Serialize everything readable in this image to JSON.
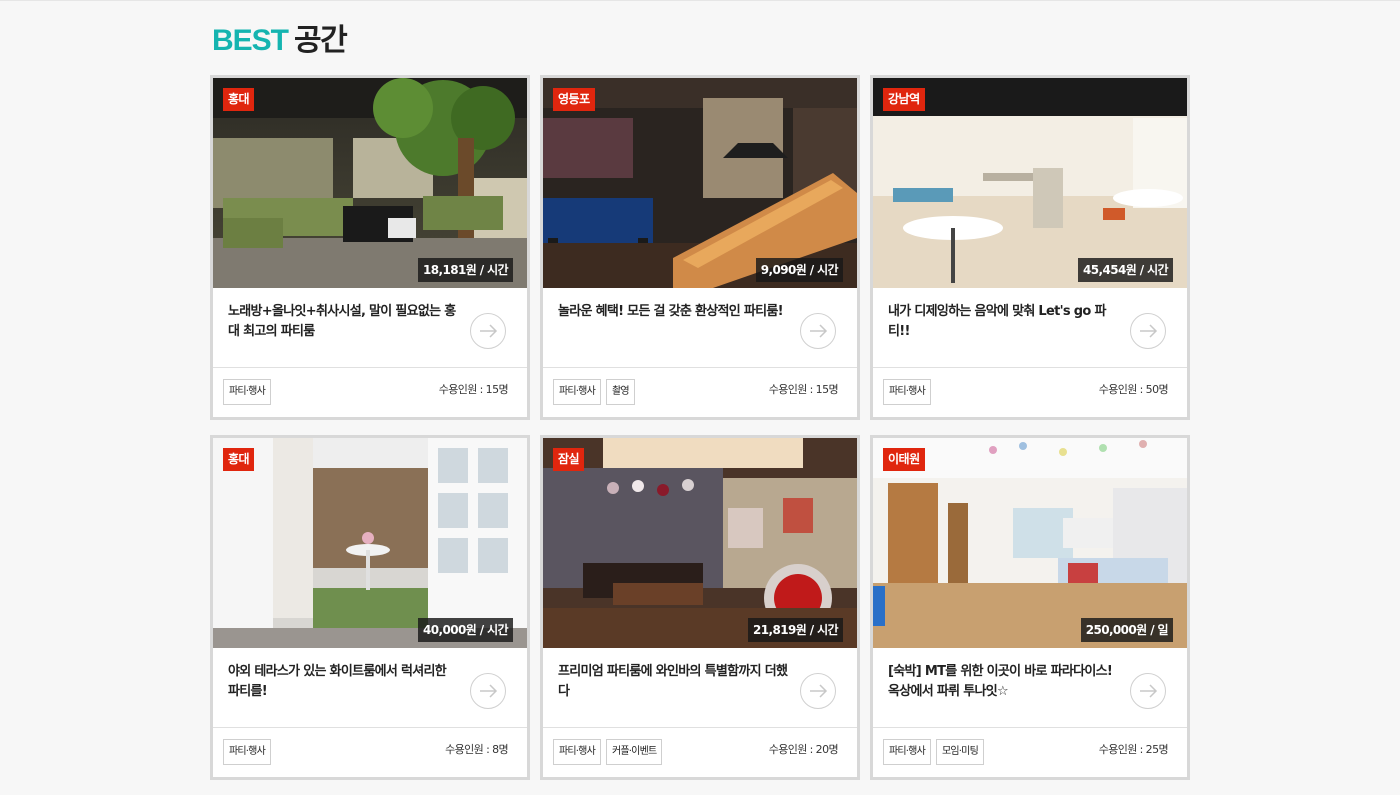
{
  "section": {
    "title_accent": "BEST",
    "title_rest": "공간"
  },
  "colors": {
    "accent": "#15b4b0",
    "badge": "#e0260e"
  },
  "cards": [
    {
      "location": "홍대",
      "price": "18,181원 / 시간",
      "description": "노래방+올나잇+취사시설, 말이 필요없는 홍대 최고의 파티룸",
      "tags": [
        "파티·행사"
      ],
      "capacity": "수용인원 : 15명"
    },
    {
      "location": "영등포",
      "price": "9,090원 / 시간",
      "description": "놀라운 혜택! 모든 걸 갖춘 환상적인 파티룸!",
      "tags": [
        "파티·행사",
        "촬영"
      ],
      "capacity": "수용인원 : 15명"
    },
    {
      "location": "강남역",
      "price": "45,454원 / 시간",
      "description": "내가 디제잉하는 음악에 맞춰 Let's go 파티!!",
      "tags": [
        "파티·행사"
      ],
      "capacity": "수용인원 : 50명"
    },
    {
      "location": "홍대",
      "price": "40,000원 / 시간",
      "description": "야외 테라스가 있는 화이트룸에서 럭셔리한 파티를!",
      "tags": [
        "파티·행사"
      ],
      "capacity": "수용인원 : 8명"
    },
    {
      "location": "잠실",
      "price": "21,819원 / 시간",
      "description": "프리미엄 파티룸에 와인바의 특별함까지 더했다",
      "tags": [
        "파티·행사",
        "커플·이벤트"
      ],
      "capacity": "수용인원 : 20명"
    },
    {
      "location": "이태원",
      "price": "250,000원 / 일",
      "description": "[숙박] MT를 위한 이곳이 바로 파라다이스! 옥상에서 파뤼 투나잇☆",
      "tags": [
        "파티·행사",
        "모임·미팅"
      ],
      "capacity": "수용인원 : 25명"
    }
  ]
}
